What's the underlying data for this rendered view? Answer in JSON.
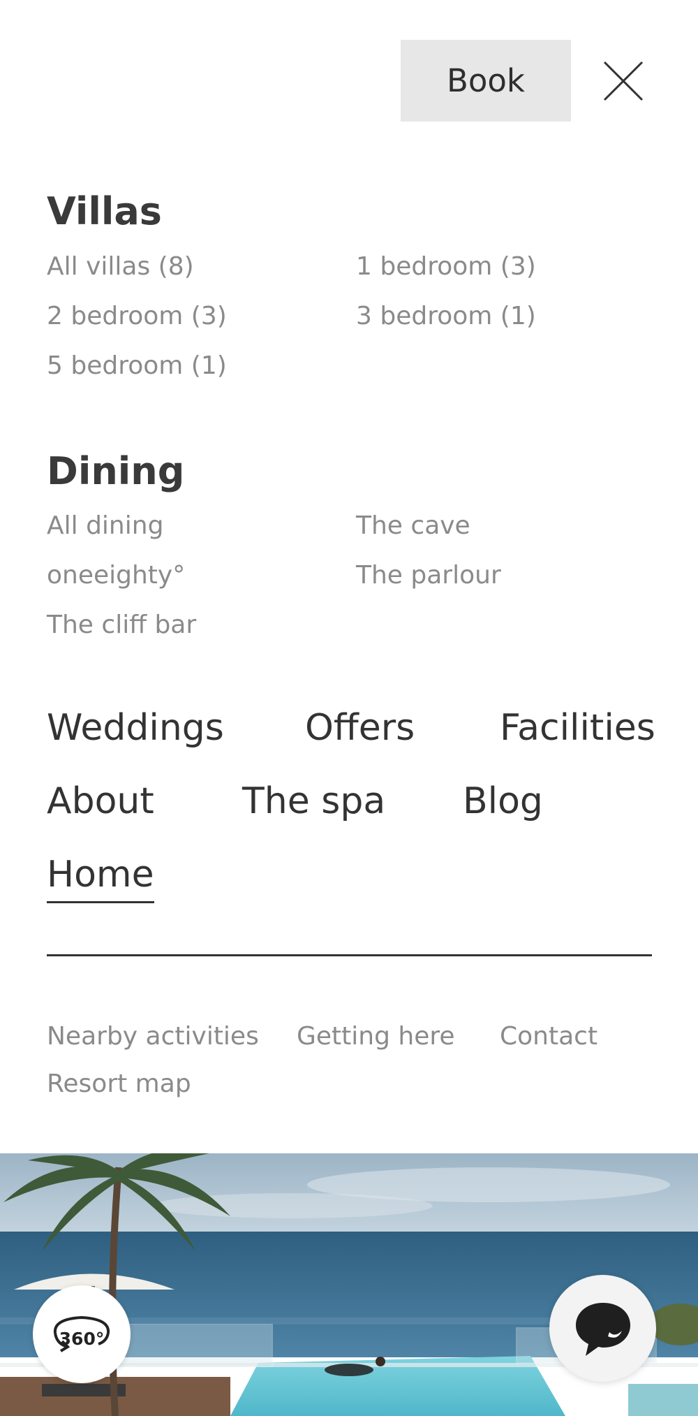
{
  "header": {
    "book_label": "Book",
    "close_icon": "close-icon"
  },
  "villas": {
    "title": "Villas",
    "links": [
      "All villas (8)",
      "1 bedroom (3)",
      "2 bedroom (3)",
      "3 bedroom (1)",
      "5 bedroom (1)"
    ]
  },
  "dining": {
    "title": "Dining",
    "links": [
      "All dining",
      "The cave",
      "oneeighty°",
      "The parlour",
      "The cliff bar"
    ]
  },
  "main_nav": {
    "items": [
      "Weddings",
      "Offers",
      "Facilities",
      "About",
      "The spa",
      "Blog",
      "Home"
    ],
    "active": "Home"
  },
  "footer_nav": {
    "items": [
      "Nearby activities",
      "Getting here",
      "Contact",
      "Resort map"
    ]
  },
  "floating": {
    "view360_label": "360°",
    "chat_icon": "chat-bubble-icon"
  },
  "colors": {
    "background": "#ffffff",
    "book_button_bg": "#e8e7e7",
    "primary_text": "#333333",
    "secondary_text": "#8a8a8a"
  }
}
